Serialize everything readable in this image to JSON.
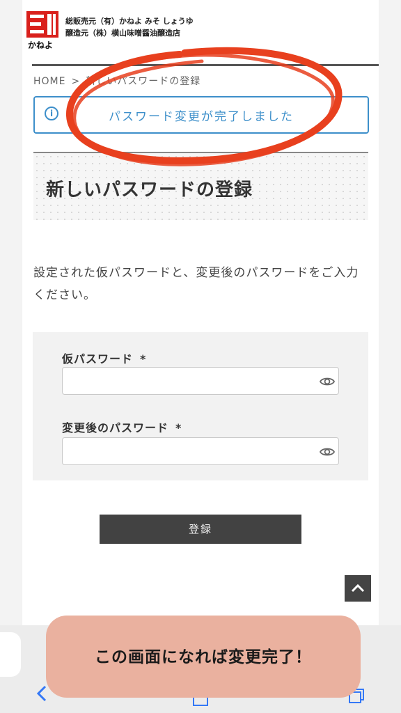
{
  "header": {
    "logo_text": "かねよ",
    "company_line1": "総販売元（有）かねよ みそ しょうゆ",
    "company_line2": "醸造元（株）横山味噌醤油醸造店"
  },
  "breadcrumb": {
    "home": "HOME",
    "separator": ">",
    "current": "新しいパスワードの登録"
  },
  "notice": {
    "icon": "info-icon",
    "message": "パスワード変更が完了しました",
    "color": "#3d8fca"
  },
  "page_title": "新しいパスワードの登録",
  "intro": "設定された仮パスワードと、変更後のパスワードをご入力ください。",
  "form": {
    "temp_password_label": "仮パスワード",
    "new_password_label": "変更後のパスワード",
    "required_mark": "*",
    "temp_password_value": "",
    "new_password_value": "",
    "eye_icon": "eye-icon"
  },
  "submit_label": "登録",
  "back_to_top_icon": "chevron-up-icon",
  "callout": {
    "text": "この画面になれば変更完了！",
    "color": "#eab19f"
  },
  "annotation_color": "#e8401e"
}
